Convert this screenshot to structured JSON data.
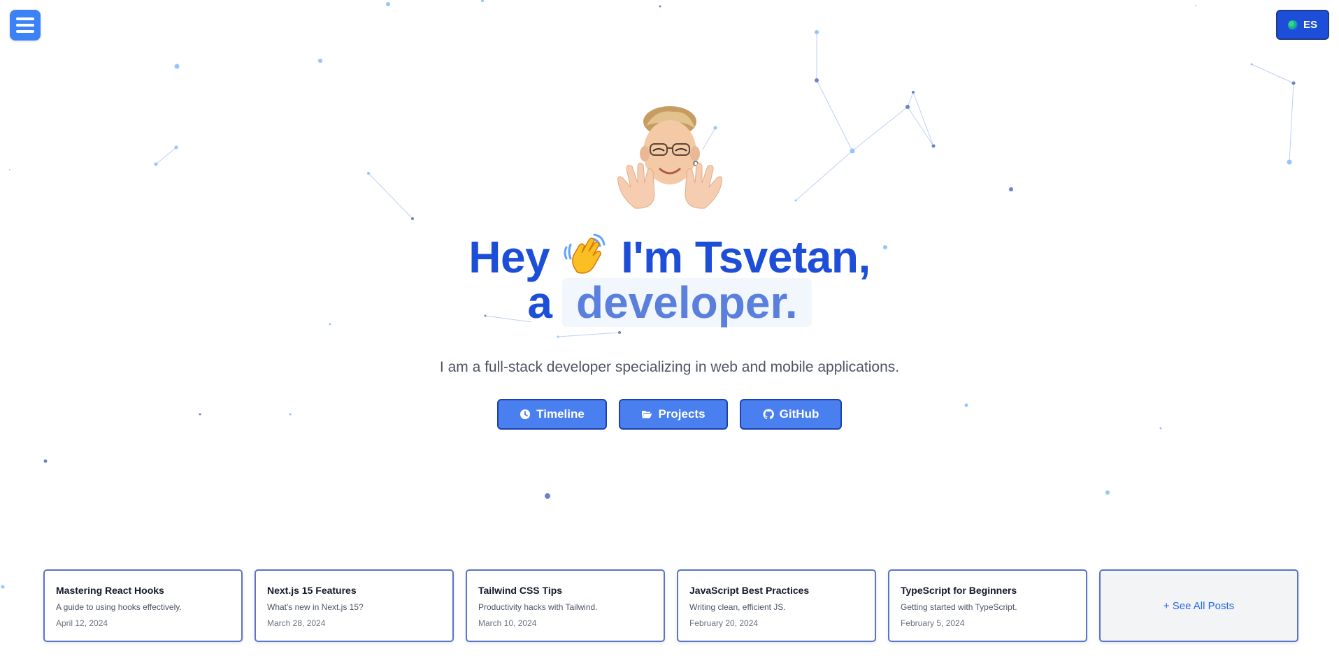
{
  "header": {
    "menu_icon": "hamburger-icon",
    "language_icon": "globe-icon",
    "language_label": "ES"
  },
  "hero": {
    "avatar_icon": "memoji-avatar-icon",
    "greeting_before": "Hey",
    "greeting_icon": "waving-hand-icon",
    "greeting_after": "I'm Tsvetan,",
    "role_prefix": "a",
    "role_word": "developer.",
    "subtitle": "I am a full-stack developer specializing in web and mobile applications."
  },
  "actions": [
    {
      "label": "Timeline",
      "icon": "clock-icon"
    },
    {
      "label": "Projects",
      "icon": "folder-open-icon"
    },
    {
      "label": "GitHub",
      "icon": "github-icon"
    }
  ],
  "posts": [
    {
      "title": "Mastering React Hooks",
      "description": "A guide to using hooks effectively.",
      "date": "April 12, 2024"
    },
    {
      "title": "Next.js 15 Features",
      "description": "What's new in Next.js 15?",
      "date": "March 28, 2024"
    },
    {
      "title": "Tailwind CSS Tips",
      "description": "Productivity hacks with Tailwind.",
      "date": "March 10, 2024"
    },
    {
      "title": "JavaScript Best Practices",
      "description": "Writing clean, efficient JS.",
      "date": "February 20, 2024"
    },
    {
      "title": "TypeScript for Beginners",
      "description": "Getting started with TypeScript.",
      "date": "February 5, 2024"
    }
  ],
  "see_all_label": "+ See All Posts",
  "colors": {
    "primary": "#1d4ed8",
    "button": "#4a7ff0",
    "particle": "#93c5fd"
  }
}
